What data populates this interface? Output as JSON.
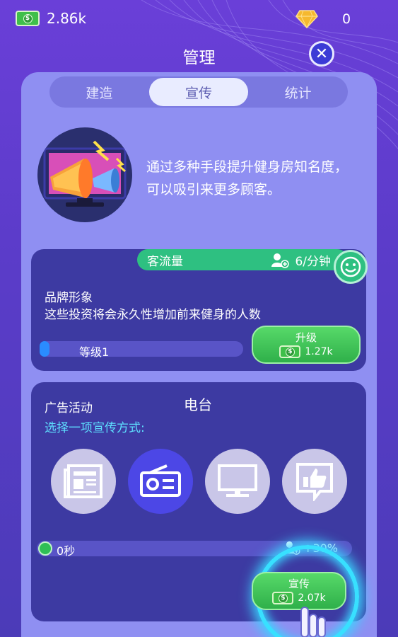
{
  "currency": {
    "money": "2.86k",
    "gems": "0"
  },
  "header": {
    "title": "管理"
  },
  "tabs": [
    {
      "label": "建造"
    },
    {
      "label": "宣传"
    },
    {
      "label": "统计"
    }
  ],
  "intro": {
    "text": "通过多种手段提升健身房知名度，可以吸引来更多顾客。"
  },
  "flow": {
    "label": "客流量",
    "rate": "6/分钟"
  },
  "brand": {
    "title": "品牌形象",
    "description": "这些投资将会永久性增加前来健身的人数",
    "level_label": "等级1",
    "level_progress": 0.05,
    "upgrade_label": "升级",
    "upgrade_cost": "1.27k"
  },
  "ads": {
    "title": "广告活动",
    "current": "电台",
    "choose": "选择一项宣传方式:",
    "media": [
      {
        "icon": "newspaper-icon",
        "selected": false
      },
      {
        "icon": "radio-icon",
        "selected": true
      },
      {
        "icon": "tv-icon",
        "selected": false
      },
      {
        "icon": "social-like-icon",
        "selected": false
      }
    ],
    "time": "0秒",
    "bonus": "+30%",
    "promote_label": "宣传",
    "promote_cost": "2.07k"
  },
  "colors": {
    "accent_green": "#2ec081",
    "panel": "#8f8ff2",
    "card": "#3d3aa2",
    "glow": "#38e0ff"
  }
}
